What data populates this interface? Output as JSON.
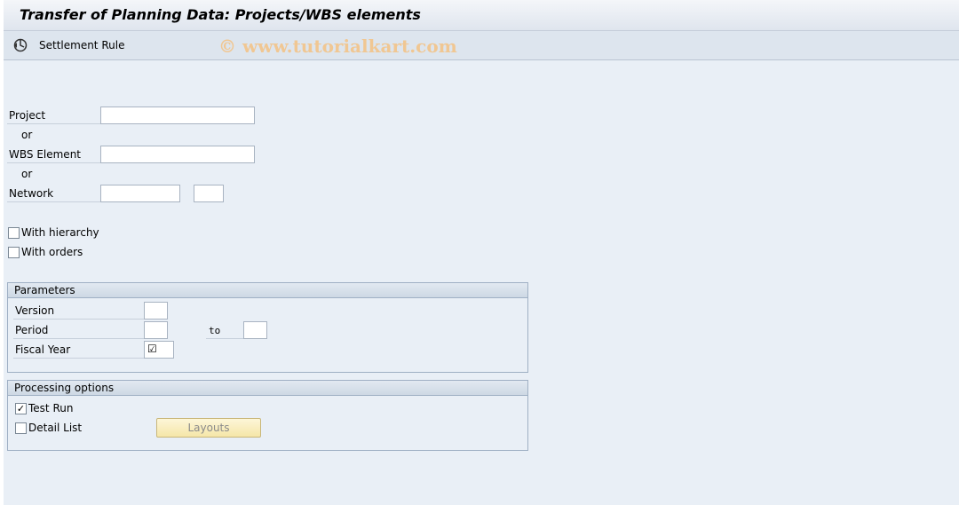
{
  "window": {
    "title": "Transfer of Planning Data: Projects/WBS elements"
  },
  "toolbar": {
    "settlement_rule_label": "Settlement Rule"
  },
  "watermark": "© www.tutorialkart.com",
  "selection": {
    "project_label": "Project",
    "or_1": "or",
    "wbs_label": "WBS Element",
    "or_2": "or",
    "network_label": "Network",
    "with_hierarchy_label": "With hierarchy",
    "with_orders_label": "With orders"
  },
  "parameters": {
    "title": "Parameters",
    "version_label": "Version",
    "period_label": "Period",
    "to_label": "to",
    "fiscal_year_label": "Fiscal Year",
    "fiscal_year_value": "☑"
  },
  "processing": {
    "title": "Processing options",
    "test_run_label": "Test Run",
    "test_run_mark": "✓",
    "detail_list_label": "Detail List",
    "layouts_label": "Layouts"
  }
}
